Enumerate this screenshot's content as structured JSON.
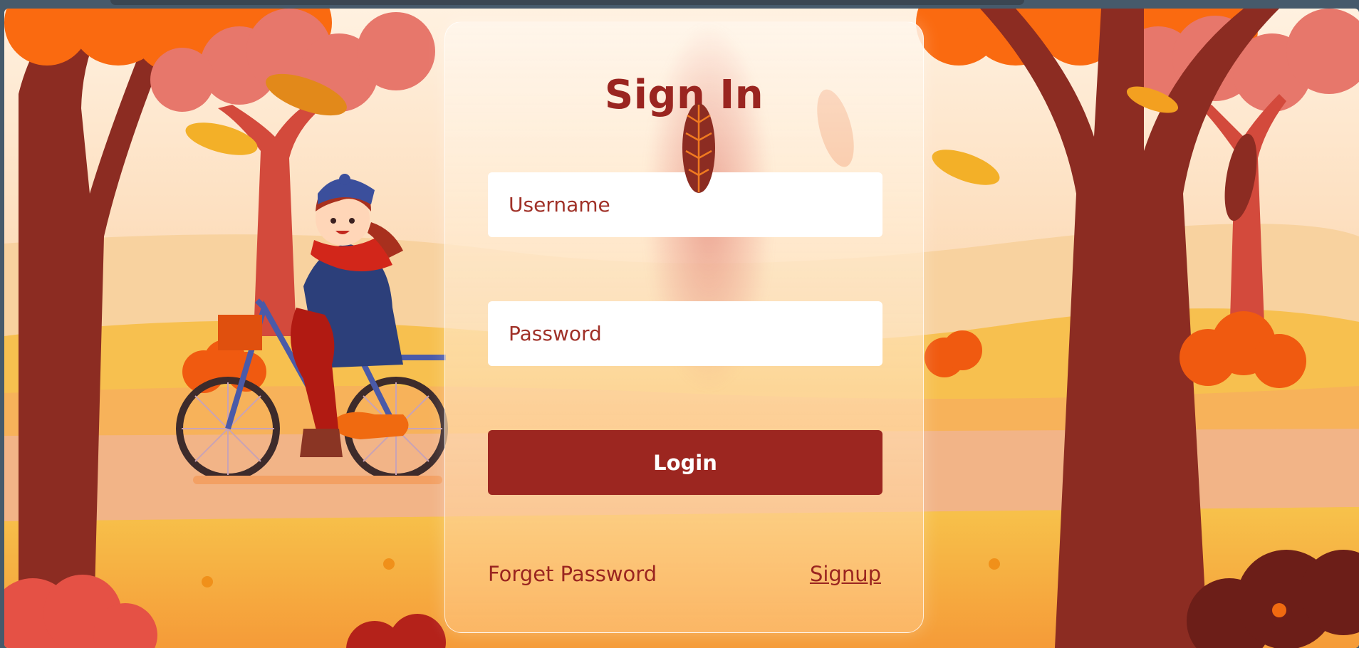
{
  "form": {
    "title": "Sign In",
    "username_placeholder": "Username",
    "password_placeholder": "Password",
    "login_label": "Login",
    "forget_label": "Forget Password",
    "signup_label": "Signup"
  },
  "colors": {
    "brand": "#9c2620",
    "page_frame": "#465a6b",
    "sky": "#fde5c8",
    "ground": "#f7b25a"
  },
  "icons": {
    "leaf": "falling-leaf-icon",
    "illustration": "autumn-bicycle-illustration"
  }
}
